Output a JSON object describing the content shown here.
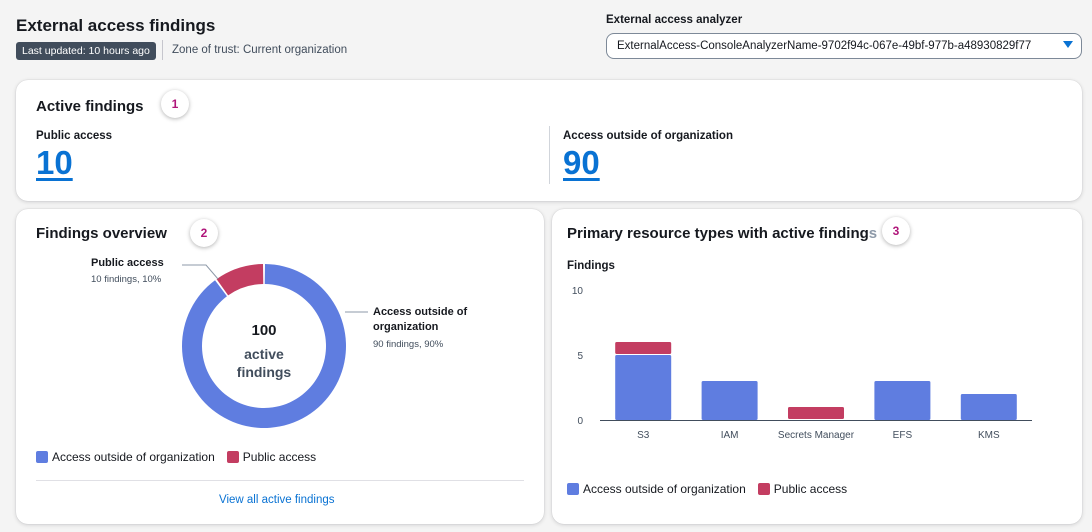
{
  "header": {
    "title": "External access findings",
    "last_updated": "Last updated: 10 hours ago",
    "zone_of_trust": "Zone of trust: Current organization"
  },
  "analyzer": {
    "label": "External access analyzer",
    "selected": "ExternalAccess-ConsoleAnalyzerName-9702f94c-067e-49bf-977b-a48930829f77"
  },
  "active_findings": {
    "title": "Active findings",
    "callout": "1",
    "public_access_label": "Public access",
    "public_access_value": "10",
    "outside_org_label": "Access outside of organization",
    "outside_org_value": "90"
  },
  "overview": {
    "title": "Findings overview",
    "callout": "2",
    "center_total": "100",
    "center_line1": "active",
    "center_line2": "findings",
    "public_label": "Public access",
    "public_sub": "10 findings, 10%",
    "outside_label_1": "Access outside of",
    "outside_label_2": "organization",
    "outside_sub": "90 findings, 90%",
    "legend_outside": "Access outside of organization",
    "legend_public": "Public access",
    "view_all": "View all active findings"
  },
  "resource_types": {
    "title_part1": "Primary resource types with active finding",
    "title_part2": "s",
    "callout": "3",
    "ylabel": "Findings",
    "legend_outside": "Access outside of organization",
    "legend_public": "Public access"
  },
  "colors": {
    "outside": "#5f7de0",
    "public": "#c33d61",
    "link": "#0972d3"
  },
  "chart_data": [
    {
      "type": "pie",
      "title": "",
      "categories": [
        "Access outside of organization",
        "Public access"
      ],
      "values": [
        90,
        10
      ]
    },
    {
      "type": "bar",
      "stacked": true,
      "title": "",
      "ylabel": "Findings",
      "categories": [
        "S3",
        "IAM",
        "Secrets Manager",
        "EFS",
        "KMS"
      ],
      "series": [
        {
          "name": "Access outside of organization",
          "values": [
            5,
            3,
            0,
            3,
            2
          ]
        },
        {
          "name": "Public access",
          "values": [
            1,
            0,
            1,
            0,
            0
          ]
        }
      ],
      "yticks": [
        0,
        5,
        10
      ],
      "ylim": [
        0,
        10
      ],
      "grid": false,
      "legend": "bottom"
    }
  ]
}
